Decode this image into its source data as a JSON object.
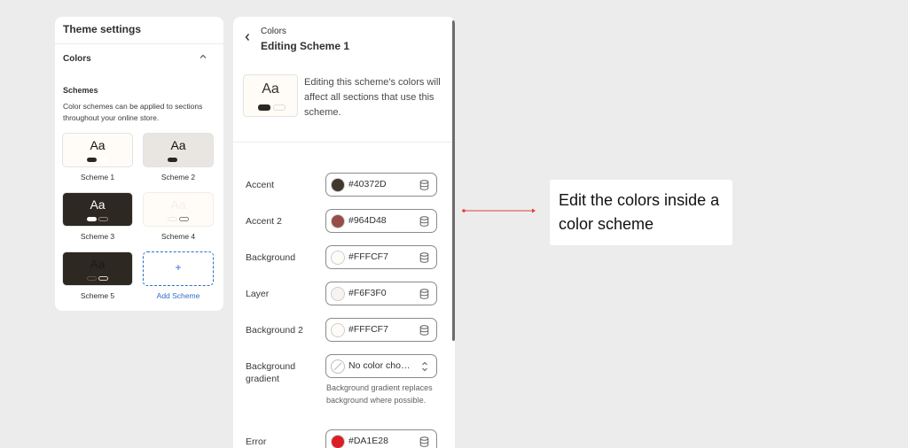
{
  "left_panel": {
    "title": "Theme settings",
    "section": "Colors",
    "schemes_heading": "Schemes",
    "schemes_description": "Color schemes can be applied to sections throughout your online store.",
    "schemes": [
      {
        "name": "Scheme 1",
        "preview": "Aa",
        "background": "#FFFCF7",
        "text": "#111111",
        "pill1": "#2b2622",
        "pill2": "#FFFFFF"
      },
      {
        "name": "Scheme 2",
        "preview": "Aa",
        "background": "#E9E6E2",
        "text": "#111111",
        "pill1": "#2b2622",
        "pill2": "#E9E6E2"
      },
      {
        "name": "Scheme 3",
        "preview": "Aa",
        "background": "#2E2822",
        "text": "#FFFFFF",
        "pill1": "#FFFFFF",
        "pill2": "#2E2822"
      },
      {
        "name": "Scheme 4",
        "preview": "Aa",
        "background": "#FFFCF7",
        "text": "#F5EEE6",
        "pill1": "#FFFCF7",
        "pill2": "#FFFCF7"
      },
      {
        "name": "Scheme 5",
        "preview": "Aa",
        "background": "#2E2822",
        "text": "#1E1A16",
        "pill1": "#2E2822",
        "pill2": "#2E2822"
      }
    ],
    "add_scheme": {
      "label": "Add Scheme",
      "icon": "+"
    }
  },
  "right_panel": {
    "breadcrumb": "Colors",
    "title": "Editing Scheme 1",
    "preview": {
      "text": "Aa"
    },
    "info": "Editing this scheme's colors will affect all sections that use this scheme.",
    "fields": [
      {
        "label": "Accent",
        "value": "#40372D",
        "color": "#40372D"
      },
      {
        "label": "Accent 2",
        "value": "#964D48",
        "color": "#964D48"
      },
      {
        "label": "Background",
        "value": "#FFFCF7",
        "color": "#FFFCF7"
      },
      {
        "label": "Layer",
        "value": "#F6F3F0",
        "color": "#F6F3F0"
      },
      {
        "label": "Background 2",
        "value": "#FFFCF7",
        "color": "#FFFCF7"
      },
      {
        "label": "Background gradient",
        "value": "No color cho…",
        "color": null
      },
      {
        "label": "Error",
        "value": "#DA1E28",
        "color": "#DA1E28"
      }
    ],
    "gradient_help": "Background gradient replaces background where possible."
  },
  "annotation": {
    "text": "Edit the colors inside a color scheme",
    "arrow_color": "#E0403A"
  },
  "icons": {
    "back": "chevron-left-icon",
    "collapse": "chevron-up-icon",
    "field_action": "database-icon",
    "select": "select-chevrons-icon"
  }
}
